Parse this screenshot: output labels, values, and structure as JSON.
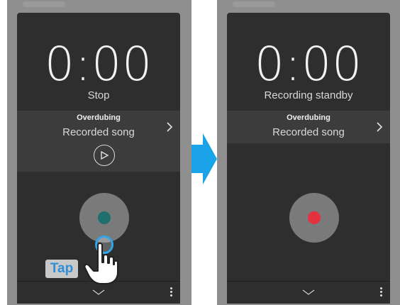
{
  "colors": {
    "screen_bg": "#2e2e2e",
    "panel_bg": "#3c3c3c",
    "record_button_bg": "#7a7a7a",
    "record_dot_stopped": "#1f6f6f",
    "record_dot_standby": "#e53040",
    "arrow": "#1aa3e8",
    "tap_text": "#2f8fd6"
  },
  "left_screen": {
    "timer": "0:00",
    "status": "Stop",
    "mode_label": "Overdubing",
    "song_name": "Recorded song"
  },
  "right_screen": {
    "timer": "0:00",
    "status": "Recording standby",
    "mode_label": "Overdubing",
    "song_name": "Recorded song"
  },
  "annotation": {
    "tap_label": "Tap"
  },
  "icons": {
    "chevron_right": "chevron-right-icon",
    "play": "play-icon",
    "chevron_down": "chevron-down-icon",
    "menu": "more-vertical-icon",
    "hand": "tap-hand-icon"
  }
}
